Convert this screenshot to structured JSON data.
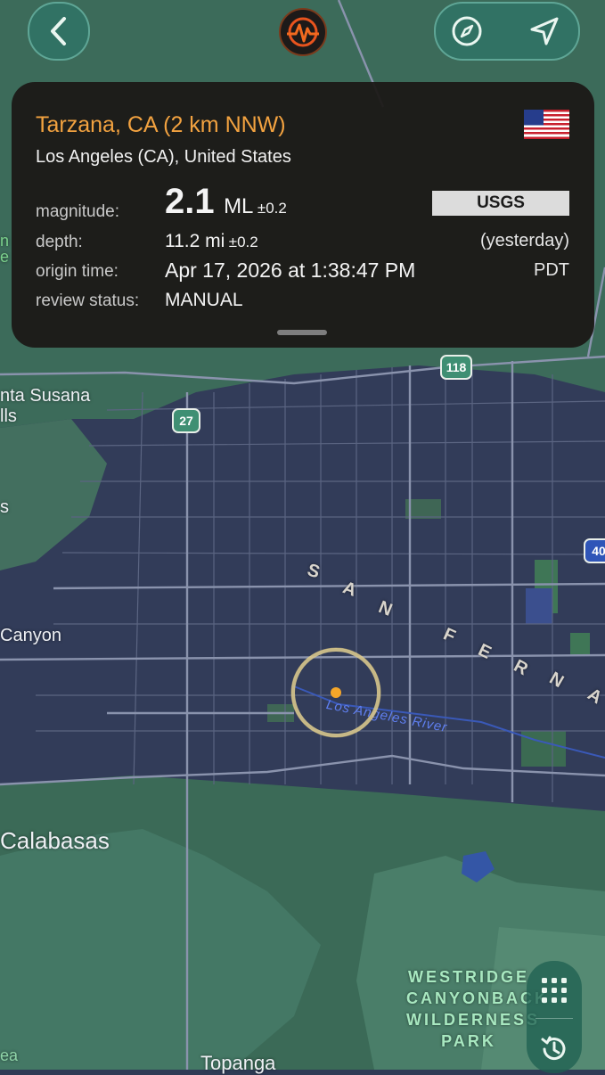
{
  "app": {
    "logo_icon": "seismograph-icon",
    "accent": "#f2a240"
  },
  "nav": {
    "back_icon": "chevron-left-icon",
    "compass_icon": "compass-icon",
    "location_icon": "location-arrow-icon"
  },
  "quake": {
    "place": "Tarzana, CA (2 km NNW)",
    "region": "Los Angeles (CA), United States",
    "flag_icon": "us-flag-icon",
    "labels": {
      "magnitude": "magnitude:",
      "depth": "depth:",
      "origin_time": "origin time:",
      "review_status": "review status:"
    },
    "magnitude": "2.1",
    "magnitude_type": "ML",
    "magnitude_err": "±0.2",
    "depth": "11.2 mi",
    "depth_err": "±0.2",
    "origin_time": "Apr 17, 2026 at 1:38:47 PM",
    "relative_time": "(yesterday)",
    "timezone": "PDT",
    "review_status": "MANUAL",
    "source": "USGS"
  },
  "map": {
    "labels": {
      "santa_susana_1": "nta Susana",
      "santa_susana_2": "lls",
      "canyon": "Canyon",
      "calabasas": "Calabasas",
      "topanga": "Topanga",
      "westridge_1": "WESTRIDGE",
      "westridge_2": "CANYONBACK",
      "westridge_3": "WILDERNESS",
      "westridge_4": "PARK",
      "river": "Los Angeles River",
      "left_edge_1": "n",
      "left_edge_2": "e",
      "left_edge_3": "s",
      "left_edge_4": "ea",
      "valley_letters": [
        "S",
        "A",
        "N",
        "F",
        "E",
        "R",
        "N",
        "A"
      ]
    },
    "shields": {
      "ca118": "118",
      "ca27": "27",
      "i405": "40"
    }
  },
  "controls": {
    "grid_icon": "grid-icon",
    "history_icon": "history-icon"
  }
}
